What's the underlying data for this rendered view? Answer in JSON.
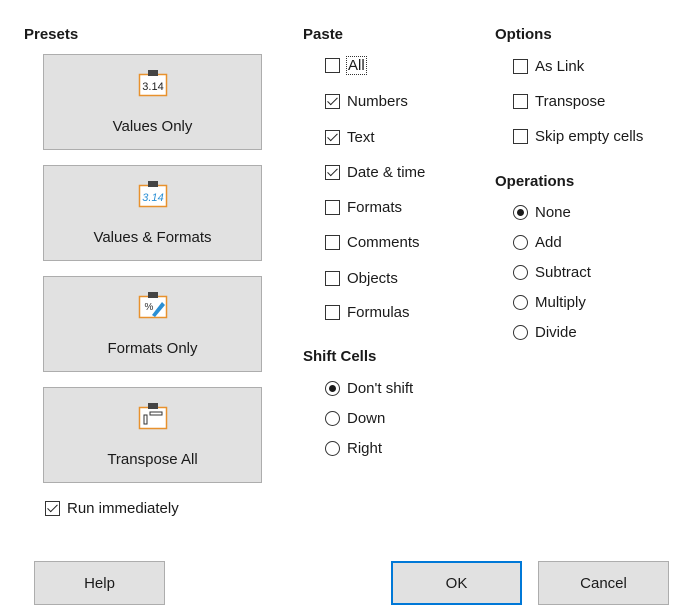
{
  "presets": {
    "heading": "Presets",
    "buttons": [
      {
        "label": "Values Only",
        "icon": "clipboard-values-icon"
      },
      {
        "label": "Values & Formats",
        "icon": "clipboard-values-formats-icon"
      },
      {
        "label": "Formats Only",
        "icon": "clipboard-formats-icon"
      },
      {
        "label": "Transpose All",
        "icon": "clipboard-transpose-icon"
      }
    ],
    "icon_text": "3.14",
    "run_immediately": {
      "label": "Run immediately",
      "checked": true
    }
  },
  "paste": {
    "heading": "Paste",
    "items": [
      {
        "label": "All",
        "checked": false
      },
      {
        "label": "Numbers",
        "checked": true
      },
      {
        "label": "Text",
        "checked": true
      },
      {
        "label": "Date & time",
        "checked": true
      },
      {
        "label": "Formats",
        "checked": false
      },
      {
        "label": "Comments",
        "checked": false
      },
      {
        "label": "Objects",
        "checked": false
      },
      {
        "label": "Formulas",
        "checked": false
      }
    ]
  },
  "shift_cells": {
    "heading": "Shift Cells",
    "items": [
      {
        "label": "Don't shift",
        "selected": true
      },
      {
        "label": "Down",
        "selected": false
      },
      {
        "label": "Right",
        "selected": false
      }
    ]
  },
  "options": {
    "heading": "Options",
    "items": [
      {
        "label": "As Link",
        "checked": false
      },
      {
        "label": "Transpose",
        "checked": false
      },
      {
        "label": "Skip empty cells",
        "checked": false
      }
    ]
  },
  "operations": {
    "heading": "Operations",
    "items": [
      {
        "label": "None",
        "selected": true
      },
      {
        "label": "Add",
        "selected": false
      },
      {
        "label": "Subtract",
        "selected": false
      },
      {
        "label": "Multiply",
        "selected": false
      },
      {
        "label": "Divide",
        "selected": false
      }
    ]
  },
  "footer": {
    "help": "Help",
    "ok": "OK",
    "cancel": "Cancel"
  },
  "colors": {
    "accent": "#0078d7",
    "icon_orange": "#e8912d",
    "icon_blue": "#2a8fd4"
  }
}
